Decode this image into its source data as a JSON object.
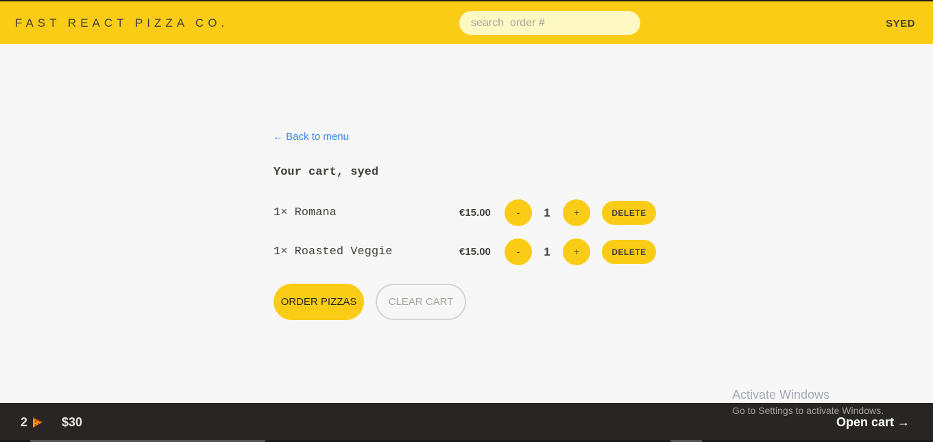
{
  "header": {
    "logo": "Fast React Pizza Co.",
    "search_placeholder": "search  order #",
    "username": "syed"
  },
  "cart": {
    "back_link": "← Back to menu",
    "title": "Your cart, syed",
    "items": [
      {
        "name": "1× Romana",
        "price": "€15.00",
        "quantity": "1",
        "decrement": "-",
        "increment": "+",
        "delete_label": "Delete"
      },
      {
        "name": "1× Roasted Veggie",
        "price": "€15.00",
        "quantity": "1",
        "decrement": "-",
        "increment": "+",
        "delete_label": "Delete"
      }
    ],
    "order_button": "Order pizzas",
    "clear_button": "Clear cart"
  },
  "footer": {
    "pizza_count": "2",
    "pizza_icon": "pizza-slice-icon",
    "total": "$30",
    "open_cart": "Open cart →"
  },
  "watermark": {
    "title": "Activate Windows",
    "subtitle": "Go to Settings to activate Windows."
  },
  "colors": {
    "accent": "#facc15",
    "header_bg": "#facc15",
    "search_bg": "#fef9c3",
    "footer_bg": "#292524",
    "link": "#3b82f6",
    "text": "#44403c"
  }
}
